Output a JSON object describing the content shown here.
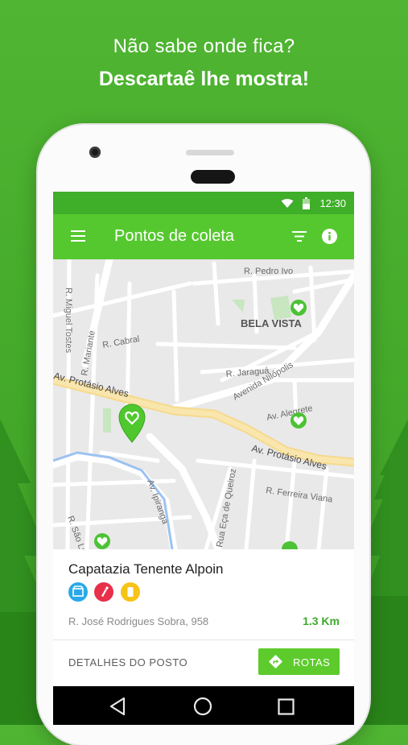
{
  "headline": {
    "line1": "Não sabe onde fica?",
    "line2": "Descartaê lhe mostra!"
  },
  "status_bar": {
    "time": "12:30"
  },
  "app_bar": {
    "title": "Pontos de coleta",
    "icons": [
      "menu-icon",
      "filter-icon",
      "info-icon"
    ]
  },
  "map": {
    "labels": {
      "pedro_ivo": "R. Pedro Ivo",
      "bela_vista": "BELA VISTA",
      "miguel_tostes": "R. Miguel Tostes",
      "mariante": "R. Mariante",
      "cabral": "R. Cabral",
      "jaragua": "R. Jaraguá",
      "nilopolis": "Avenida Nilópolis",
      "alegrete": "Av. Alegrete",
      "protasio_w": "Av. Protásio Alves",
      "protasio_e": "Av. Protásio Alves",
      "ipiranga": "Av. Ipiranga",
      "queiroz": "Rua Eça de Queiroz",
      "ferreira_viana": "R. Ferreira Viana",
      "sao_luis": "R. São Luís"
    }
  },
  "place": {
    "name": "Capatazia Tenente Alpoin",
    "categories": [
      "box-icon",
      "bottle-icon",
      "can-icon"
    ],
    "address": "R. José Rodrigues Sobra, 958",
    "distance": "1.3 Km"
  },
  "actions": {
    "details": "DETALHES DO POSTO",
    "routes": "ROTAS"
  },
  "colors": {
    "background": "#45ab2b",
    "app_bar": "#56c82f",
    "status_bar": "#3fae29",
    "accent": "#5dcb2c",
    "distance": "#3daa2d"
  }
}
